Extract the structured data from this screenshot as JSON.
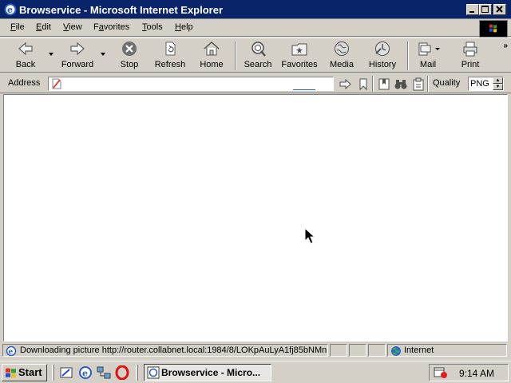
{
  "window": {
    "title": "Browservice - Microsoft Internet Explorer",
    "controls": [
      "minimize",
      "maximize",
      "close"
    ]
  },
  "menu": [
    "File",
    "Edit",
    "View",
    "Favorites",
    "Tools",
    "Help"
  ],
  "menu_underline": [
    "F",
    "E",
    "V",
    "a",
    "T",
    "H"
  ],
  "toolbar": {
    "back": "Back",
    "forward": "Forward",
    "stop": "Stop",
    "refresh": "Refresh",
    "home": "Home",
    "search": "Search",
    "favorites": "Favorites",
    "media": "Media",
    "history": "History",
    "mail": "Mail",
    "print": "Print",
    "more": "»"
  },
  "address": {
    "label": "Address",
    "value": "",
    "quality_label": "Quality",
    "quality_value": "PNG"
  },
  "status": {
    "message": "Downloading picture http://router.collabnet.local:1984/8/LOKpAuLyA1fj85bNMn",
    "zone": "Internet"
  },
  "taskbar": {
    "start": "Start",
    "task": "Browservice - Micro...",
    "clock": "9:14 AM"
  },
  "colors": {
    "titlebar": "#0a246a",
    "face": "#d4d0c8",
    "content": "#ffffff"
  }
}
